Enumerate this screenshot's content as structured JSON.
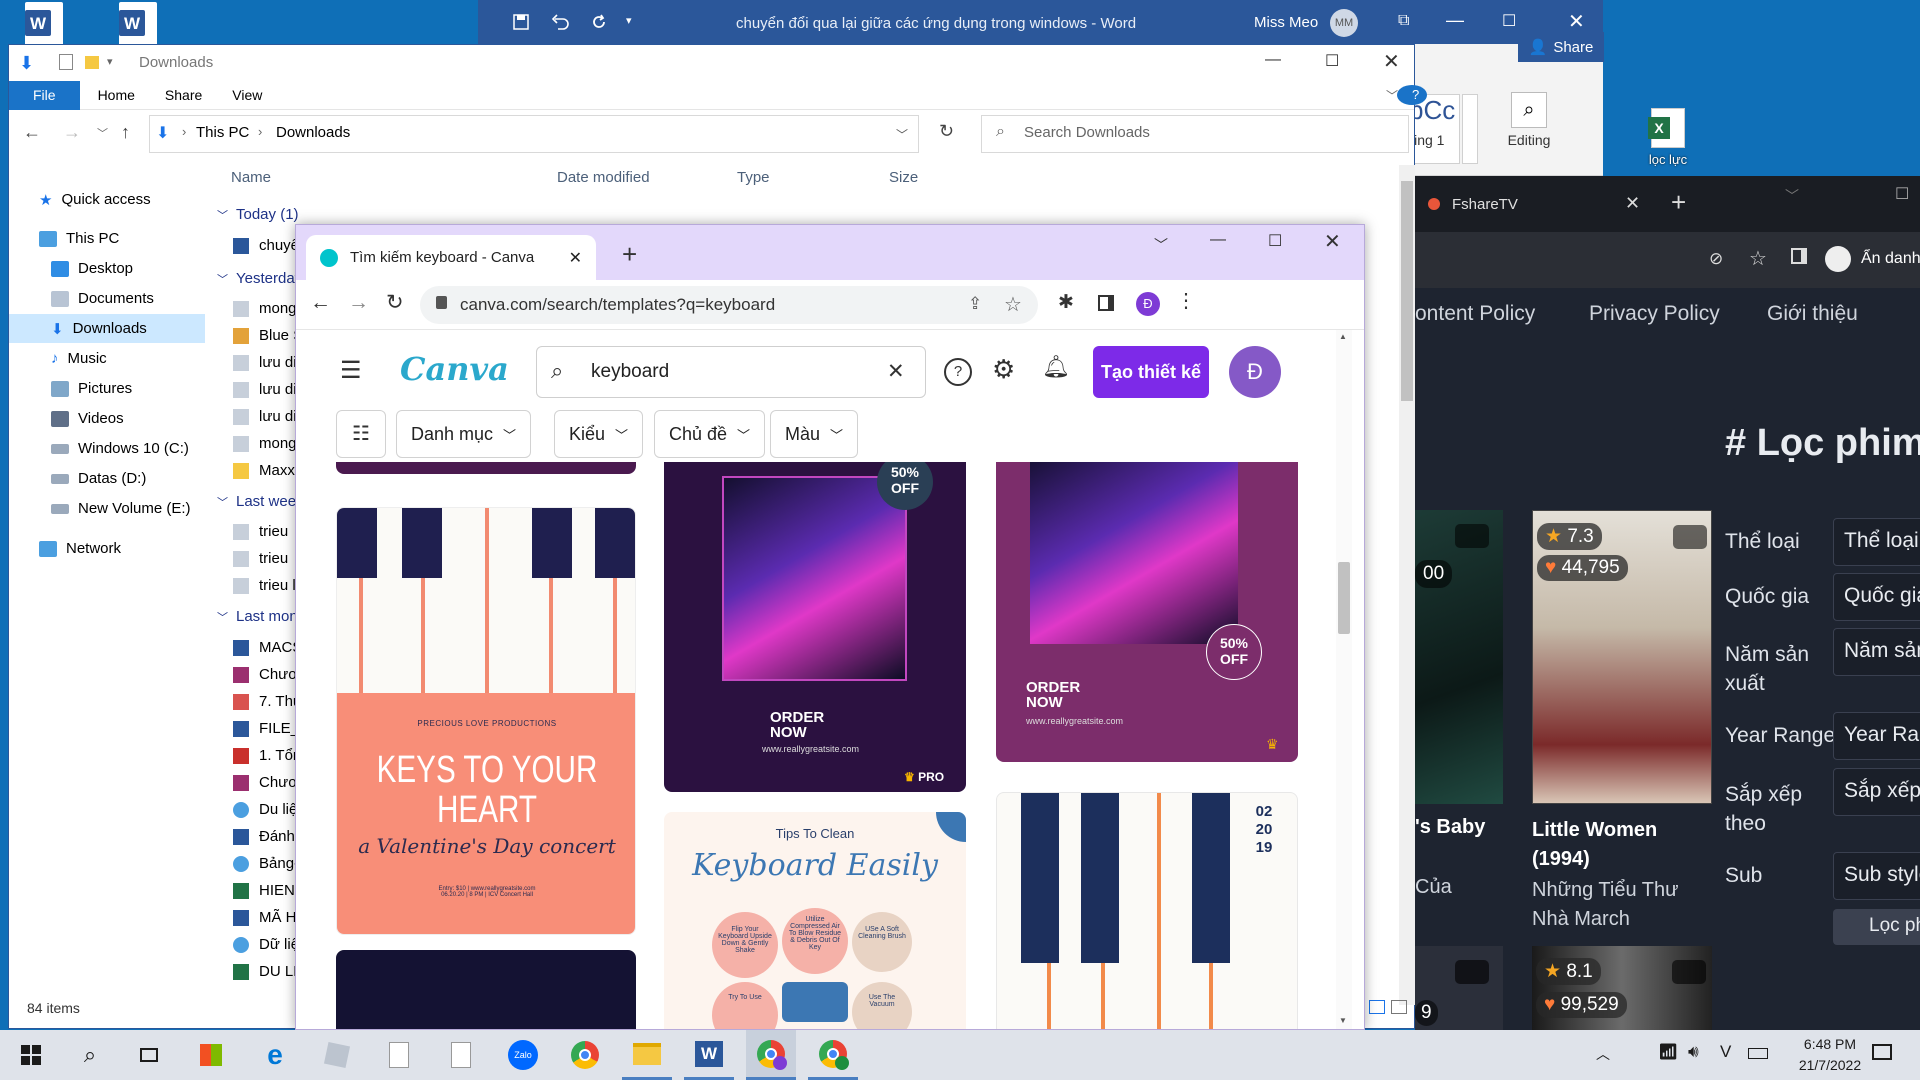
{
  "desktop": {
    "excel_icon_label": "lọc lực"
  },
  "word": {
    "title": "chuyển đổi qua lại giữa các ứng dụng trong windows  -  Word",
    "user_name": "Miss Meo",
    "user_initials": "MM",
    "share_label": "Share",
    "style_preview": "bCc",
    "style_name": "ling 1",
    "editing_label": "Editing"
  },
  "fshare": {
    "tab_title": "FshareTV",
    "incognito_label": "Ẩn danh",
    "nav": [
      "ontent Policy",
      "Privacy Policy",
      "Giới thiệu"
    ],
    "heading": "# Lọc phim",
    "filters": [
      {
        "label": "Thể loại",
        "value": "Thể loại"
      },
      {
        "label": "Quốc gia",
        "value": "Quốc gia"
      },
      {
        "label": "Năm sản xuất",
        "value": "Năm sản"
      },
      {
        "label": "Year Range",
        "value": "Year Range"
      },
      {
        "label": "Sắp xếp theo",
        "value": "Sắp xếp t"
      },
      {
        "label": "Sub",
        "value": "Sub style"
      }
    ],
    "filter_button": "Lọc phi",
    "movie1": {
      "rating": "7.3",
      "likes": "44,795",
      "title": "Little Women (1994)",
      "subtitle": "Những Tiểu Thư Nhà March"
    },
    "movie0": {
      "partial_title": "'s Baby",
      "partial_sub": "Của",
      "partial_count": "00"
    },
    "movie2": {
      "rating": "8.1",
      "likes": "99,529"
    },
    "movie3": {
      "partial_count": "9"
    }
  },
  "explorer": {
    "title": "Downloads",
    "tabs": [
      "File",
      "Home",
      "Share",
      "View"
    ],
    "breadcrumb": [
      "This PC",
      "Downloads"
    ],
    "search_placeholder": "Search Downloads",
    "columns": [
      "Name",
      "Date modified",
      "Type",
      "Size"
    ],
    "sidebar": [
      {
        "label": "Quick access",
        "icon": "star-icon"
      },
      {
        "label": "This PC",
        "icon": "computer-icon"
      },
      {
        "label": "Desktop",
        "icon": "desktop-icon"
      },
      {
        "label": "Documents",
        "icon": "documents-icon"
      },
      {
        "label": "Downloads",
        "icon": "download-icon"
      },
      {
        "label": "Music",
        "icon": "music-icon"
      },
      {
        "label": "Pictures",
        "icon": "pictures-icon"
      },
      {
        "label": "Videos",
        "icon": "videos-icon"
      },
      {
        "label": "Windows 10 (C:)",
        "icon": "drive-icon"
      },
      {
        "label": "Datas (D:)",
        "icon": "drive-icon"
      },
      {
        "label": "New Volume (E:)",
        "icon": "drive-icon"
      },
      {
        "label": "Network",
        "icon": "network-icon"
      }
    ],
    "groups": [
      "Today (1)",
      "Yesterday",
      "Last week",
      "Last month"
    ],
    "files": [
      "chuyể",
      "mong",
      "Blue S",
      "lưu di",
      "lưu di",
      "lưu di",
      "mong",
      "MaxxA",
      "trieu",
      "trieu",
      "trieu l",
      "MACS",
      "Chươn",
      "7. Thù",
      "FILE_2",
      "1. Tổn",
      "Chươn",
      "Du liệ",
      "Đánh",
      "Bảng-",
      "HIEN",
      "MÃ H",
      "Dữ liệ",
      "DU LI"
    ],
    "status": "84 items"
  },
  "canva": {
    "tab_title": "Tìm kiếm keyboard - Canva",
    "url": "canva.com/search/templates?q=keyboard",
    "profile_initial": "Đ",
    "logo": "Canva",
    "search_value": "keyboard",
    "create_button": "Tạo thiết kế",
    "filters": [
      "Danh mục",
      "Kiểu",
      "Chủ đề",
      "Màu"
    ],
    "cards": {
      "keys_small": "PRECIOUS LOVE PRODUCTIONS",
      "keys_title": "KEYS TO YOUR HEART",
      "keys_subtitle": "a Valentine's Day concert",
      "keys_details": "Entry: $10 | www.reallygreatsite.com\n06.20.20 | 8 PM | ICV Concert Hall",
      "discount": "50% OFF",
      "order_now": "ORDER NOW",
      "site": "www.reallygreatsite.com",
      "pro_badge": "PRO",
      "tips_top": "Tips To Clean",
      "tips_title": "Keyboard Easily",
      "tips_1": "Flip Your Keyboard Upside Down & Gently Shake",
      "tips_2": "Utilize Compressed Air To Blow Residue & Debris Out Of Key",
      "tips_3": "USe A Soft Cleaning Brush",
      "tips_4": "Try To Use",
      "tips_5": "Use The Vacuum",
      "date_text": "02 20 19"
    }
  },
  "taskbar": {
    "time": "6:48 PM",
    "date": "21/7/2022",
    "zalo_label": "Zalo"
  }
}
